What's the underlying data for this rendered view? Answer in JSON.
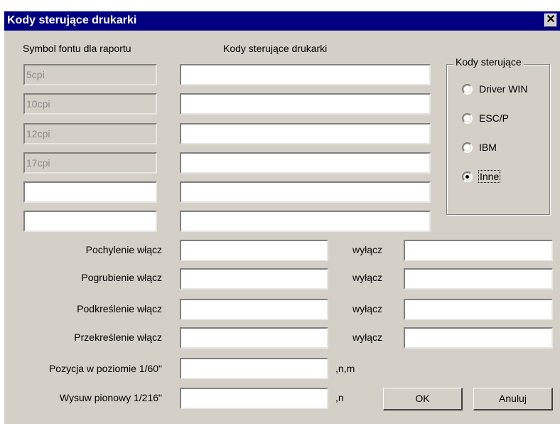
{
  "window": {
    "title": "Kody sterujące drukarki",
    "close_glyph": "✕"
  },
  "headers": {
    "font_symbol": "Symbol fontu dla raportu",
    "control_codes": "Kody sterujące drukarki"
  },
  "font_rows": [
    {
      "symbol": "5cpi",
      "code": ""
    },
    {
      "symbol": "10cpi",
      "code": ""
    },
    {
      "symbol": "12cpi",
      "code": ""
    },
    {
      "symbol": "17cpi",
      "code": ""
    },
    {
      "symbol": "",
      "code": ""
    },
    {
      "symbol": "",
      "code": ""
    }
  ],
  "codes_group": {
    "title": "Kody sterujące",
    "options": [
      "Driver WIN",
      "ESC/P",
      "IBM",
      "Inne"
    ],
    "selected": "Inne"
  },
  "styles": [
    {
      "label": "Pochylenie włącz",
      "on": "",
      "off_label": "wyłącz",
      "off": ""
    },
    {
      "label": "Pogrubienie włącz",
      "on": "",
      "off_label": "wyłącz",
      "off": ""
    },
    {
      "label": "Podkreślenie włącz",
      "on": "",
      "off_label": "wyłącz",
      "off": ""
    },
    {
      "label": "Przekreślenie włącz",
      "on": "",
      "off_label": "wyłącz",
      "off": ""
    }
  ],
  "position": {
    "horizontal_label": "Pozycja w poziomie 1/60\"",
    "horizontal_value": "",
    "horizontal_suffix": ",n,m",
    "vertical_label": "Wysuw pionowy 1/216\"",
    "vertical_value": "",
    "vertical_suffix": ",n"
  },
  "buttons": {
    "ok": "OK",
    "cancel": "Anuluj"
  }
}
